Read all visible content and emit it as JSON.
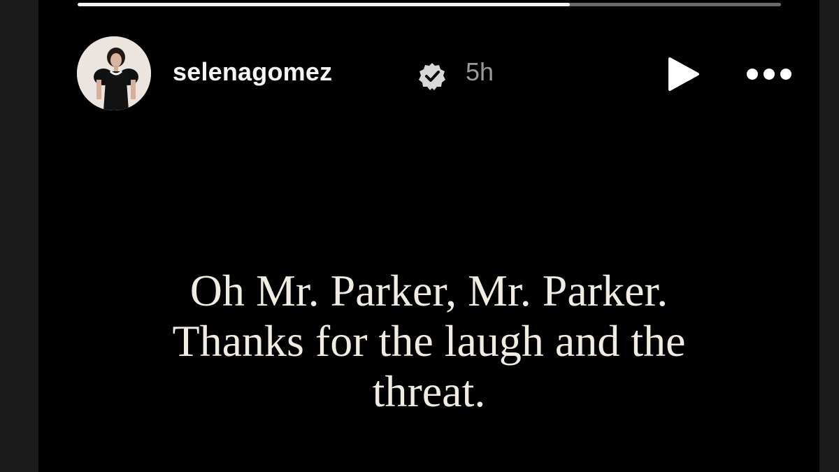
{
  "story": {
    "progress": 0.7,
    "user": {
      "username": "selenagomez",
      "verified": true,
      "verified_icon": "verified-badge-icon",
      "posted_ago": "5h"
    },
    "controls": {
      "play_icon": "play-icon",
      "more_icon": "more-options-icon"
    },
    "caption": {
      "lines": [
        "Oh Mr. Parker, Mr. Parker.",
        "Thanks for the laugh and the",
        "threat."
      ]
    },
    "colors": {
      "background": "#000000",
      "text": "#f1ece2",
      "progress_fill": "#f2f2f2",
      "progress_track": "#6b6b6b"
    }
  }
}
